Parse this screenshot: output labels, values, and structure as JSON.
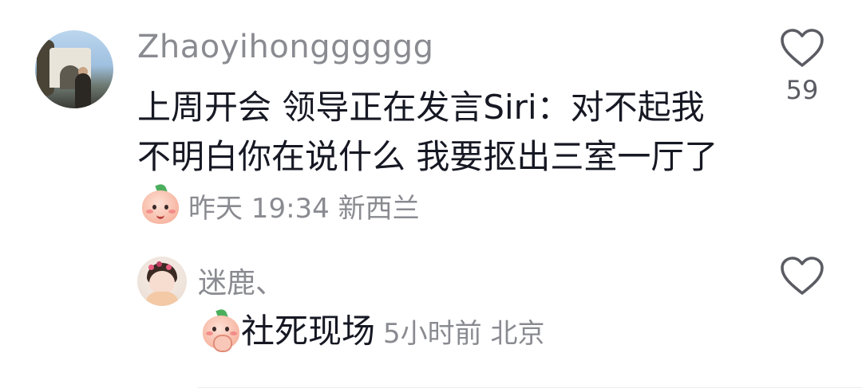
{
  "comment": {
    "username": "Zhaoyihongggggg",
    "text": "上周开会 领导正在发言Siri：对不起我不明白你在说什么 我要抠出三室一厅了",
    "emoji": "smiling-peach-emoji",
    "time": "昨天 19:34",
    "location": "新西兰",
    "like_count": "59"
  },
  "reply": {
    "username": "迷鹿、",
    "emoji": "blushing-peach-emoji",
    "text": "社死现场",
    "time": "5小时前",
    "location": "北京"
  },
  "colors": {
    "primary_text": "#161823",
    "secondary_text": "#8a8b91"
  }
}
